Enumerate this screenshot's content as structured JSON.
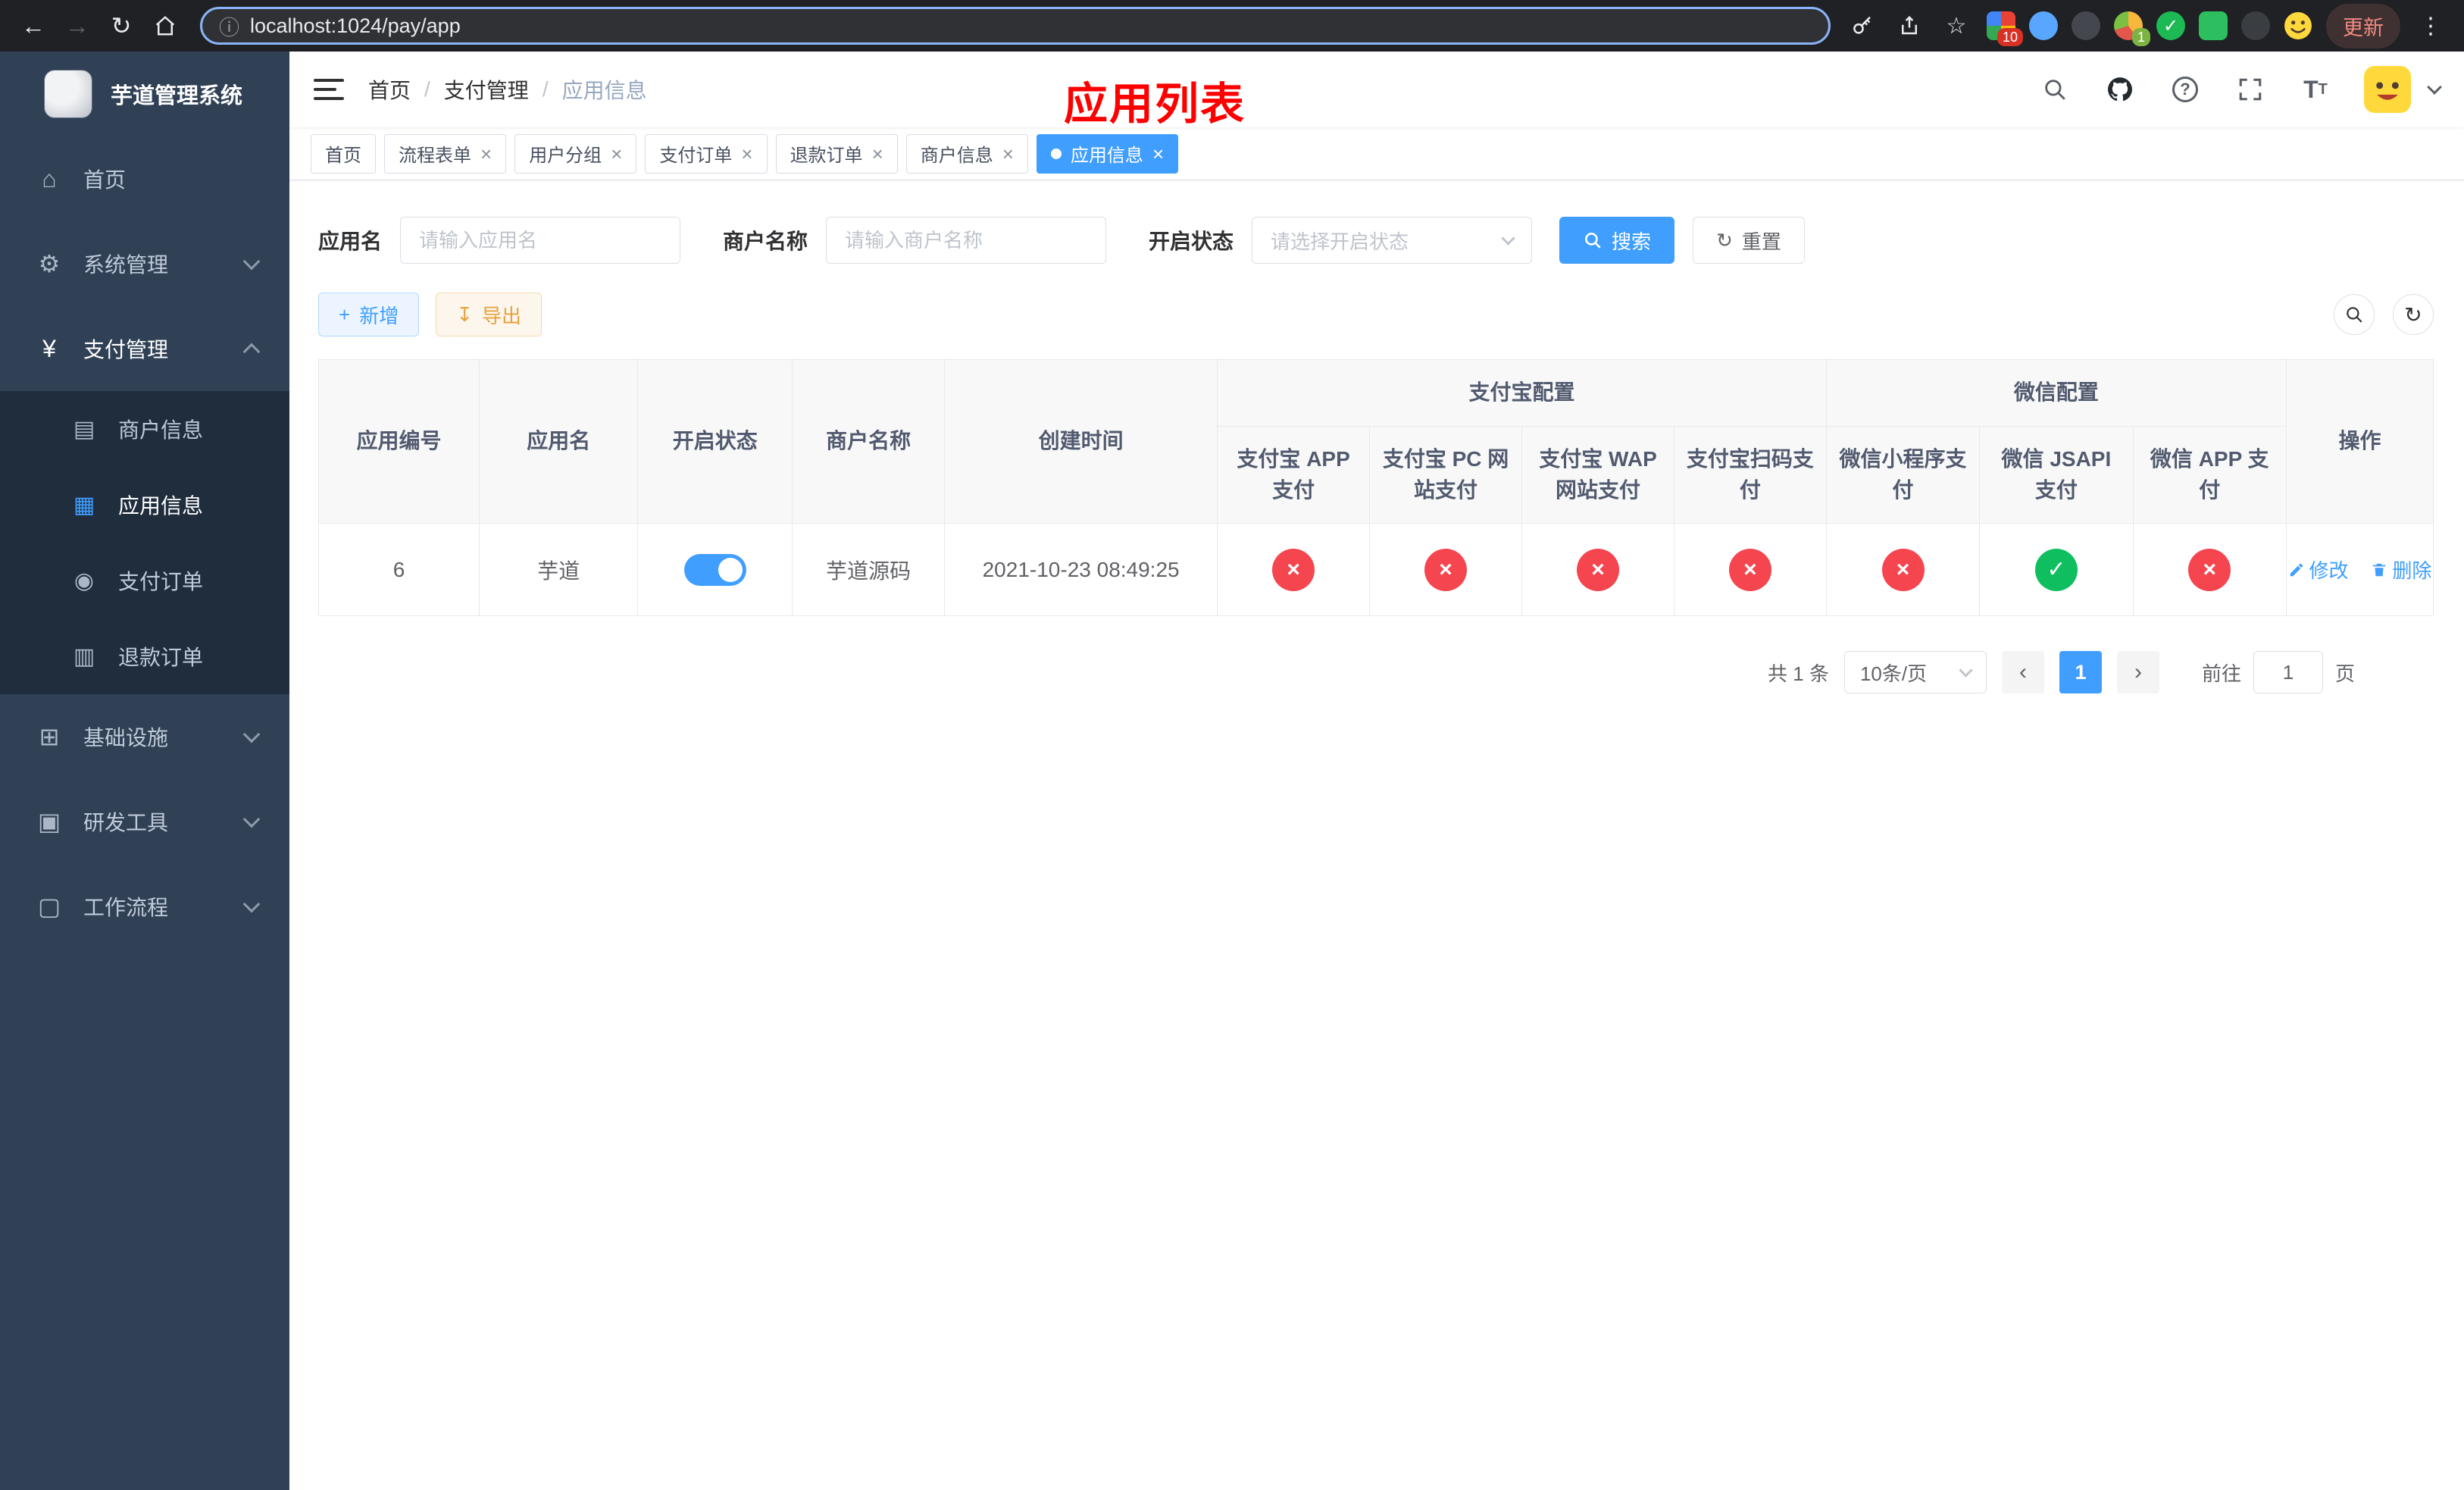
{
  "browser": {
    "url": "localhost:1024/pay/app",
    "update_label": "更新",
    "ext_badges": [
      "10",
      "1"
    ]
  },
  "app": {
    "title": "芋道管理系统",
    "overlay_title": "应用列表"
  },
  "sidebar": {
    "items": [
      {
        "label": "首页"
      },
      {
        "label": "系统管理"
      },
      {
        "label": "支付管理"
      },
      {
        "label": "基础设施"
      },
      {
        "label": "研发工具"
      },
      {
        "label": "工作流程"
      }
    ],
    "submenu": [
      {
        "label": "商户信息"
      },
      {
        "label": "应用信息"
      },
      {
        "label": "支付订单"
      },
      {
        "label": "退款订单"
      }
    ]
  },
  "breadcrumb": [
    "首页",
    "支付管理",
    "应用信息"
  ],
  "tabs": [
    {
      "label": "首页"
    },
    {
      "label": "流程表单"
    },
    {
      "label": "用户分组"
    },
    {
      "label": "支付订单"
    },
    {
      "label": "退款订单"
    },
    {
      "label": "商户信息"
    },
    {
      "label": "应用信息"
    }
  ],
  "filters": {
    "app_name": {
      "label": "应用名",
      "placeholder": "请输入应用名"
    },
    "merchant": {
      "label": "商户名称",
      "placeholder": "请输入商户名称"
    },
    "status": {
      "label": "开启状态",
      "placeholder": "请选择开启状态"
    },
    "search_label": "搜索",
    "reset_label": "重置"
  },
  "toolbar": {
    "add_label": "新增",
    "export_label": "导出"
  },
  "table": {
    "group_alipay": "支付宝配置",
    "group_wechat": "微信配置",
    "cols": {
      "id": "应用编号",
      "name": "应用名",
      "status": "开启状态",
      "merchant": "商户名称",
      "created": "创建时间",
      "alipay_app": "支付宝 APP 支付",
      "alipay_pc": "支付宝 PC 网站支付",
      "alipay_wap": "支付宝 WAP 网站支付",
      "alipay_qr": "支付宝扫码支付",
      "wx_mini": "微信小程序支付",
      "wx_jsapi": "微信 JSAPI 支付",
      "wx_app": "微信 APP 支付",
      "ops": "操作"
    },
    "status_icons": {
      "pass": "✓",
      "fail": "×"
    },
    "rows": [
      {
        "id": "6",
        "name": "芋道",
        "enabled": true,
        "merchant": "芋道源码",
        "created": "2021-10-23 08:49:25",
        "statuses": [
          false,
          false,
          false,
          false,
          false,
          true,
          false
        ],
        "edit_label": "修改",
        "delete_label": "删除"
      }
    ]
  },
  "pagination": {
    "total": "共 1 条",
    "page_size": "10条/页",
    "current": "1",
    "goto_label": "前往",
    "goto_value": "1",
    "page_label": "页"
  }
}
